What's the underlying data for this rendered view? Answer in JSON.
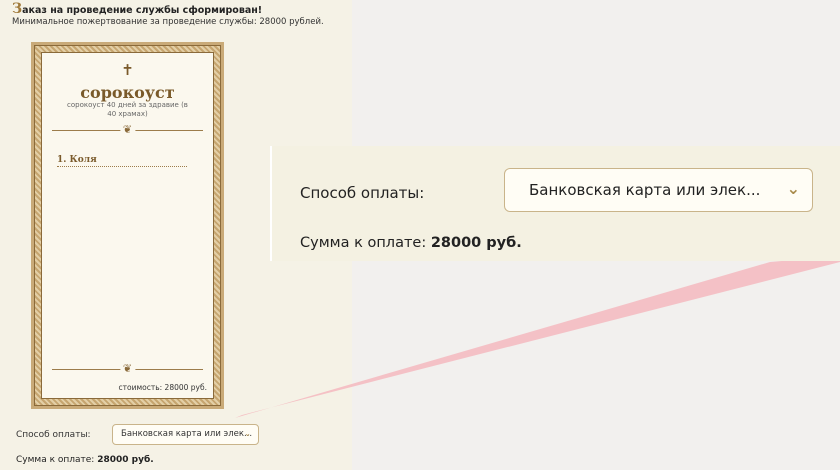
{
  "order": {
    "title_dropcap": "З",
    "title_rest": "аказ на проведение службы сформирован!",
    "min_donation": "Минимальное пожертвование за проведение службы: 28000 рублей."
  },
  "certificate": {
    "cross": "✝",
    "title": "сорокоуст",
    "subtitle": "сорокоуст 40 дней за здравие (в 40 храмах)",
    "ornament_glyph": "❦",
    "names": [
      "1. Коля"
    ],
    "cost": "стоимость: 28000 руб."
  },
  "payment": {
    "label": "Способ оплаты:",
    "selected_option": "Банковская карта или элек...",
    "sum_label": "Сумма к оплате:",
    "sum_value": "28000 руб."
  },
  "icons": {
    "chevron": "⌄"
  },
  "colors": {
    "panel_bg": "#f5f2e6",
    "accent_gold": "#a88a4a",
    "connector_pink": "#f5b8be"
  }
}
